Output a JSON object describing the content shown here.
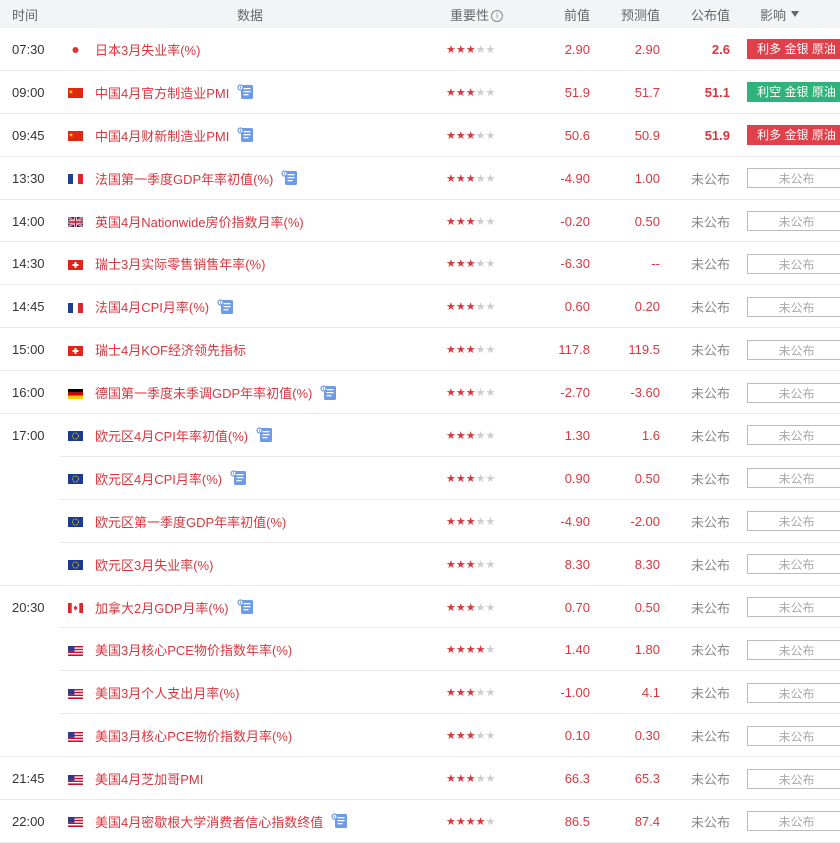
{
  "header": {
    "time": "时间",
    "data": "数据",
    "importance": "重要性",
    "previous": "前值",
    "forecast": "预测值",
    "actual": "公布值",
    "effect": "影响"
  },
  "rows": [
    {
      "time": "07:30",
      "flag": "jp",
      "name": "日本3月失业率(%)",
      "doc": false,
      "stars": 3,
      "prev": "2.90",
      "fore": "2.90",
      "act": "2.6",
      "actStyle": "bold",
      "effect": "利多 金银 原油",
      "effectStyle": "red",
      "groupEnd": true
    },
    {
      "time": "09:00",
      "flag": "cn",
      "name": "中国4月官方制造业PMI",
      "doc": true,
      "stars": 3,
      "prev": "51.9",
      "fore": "51.7",
      "act": "51.1",
      "actStyle": "bold",
      "effect": "利空 金银 原油",
      "effectStyle": "green",
      "groupEnd": true
    },
    {
      "time": "09:45",
      "flag": "cn",
      "name": "中国4月财新制造业PMI",
      "doc": true,
      "stars": 3,
      "prev": "50.6",
      "fore": "50.9",
      "act": "51.9",
      "actStyle": "bold",
      "effect": "利多 金银 原油",
      "effectStyle": "red",
      "groupEnd": true
    },
    {
      "time": "13:30",
      "flag": "fr",
      "name": "法国第一季度GDP年率初值(%)",
      "doc": true,
      "stars": 3,
      "prev": "-4.90",
      "fore": "1.00",
      "act": "未公布",
      "actStyle": "unpub",
      "effect": "未公布",
      "effectStyle": "none",
      "groupEnd": true
    },
    {
      "time": "14:00",
      "flag": "uk",
      "name": "英国4月Nationwide房价指数月率(%)",
      "doc": false,
      "stars": 3,
      "prev": "-0.20",
      "fore": "0.50",
      "act": "未公布",
      "actStyle": "unpub",
      "effect": "未公布",
      "effectStyle": "none",
      "groupEnd": true
    },
    {
      "time": "14:30",
      "flag": "ch",
      "name": "瑞士3月实际零售销售年率(%)",
      "doc": false,
      "stars": 3,
      "prev": "-6.30",
      "fore": "--",
      "act": "未公布",
      "actStyle": "unpub",
      "effect": "未公布",
      "effectStyle": "none",
      "groupEnd": true
    },
    {
      "time": "14:45",
      "flag": "fr",
      "name": "法国4月CPI月率(%)",
      "doc": true,
      "stars": 3,
      "prev": "0.60",
      "fore": "0.20",
      "act": "未公布",
      "actStyle": "unpub",
      "effect": "未公布",
      "effectStyle": "none",
      "groupEnd": true
    },
    {
      "time": "15:00",
      "flag": "ch",
      "name": "瑞士4月KOF经济领先指标",
      "doc": false,
      "stars": 3,
      "prev": "117.8",
      "fore": "119.5",
      "act": "未公布",
      "actStyle": "unpub",
      "effect": "未公布",
      "effectStyle": "none",
      "groupEnd": true
    },
    {
      "time": "16:00",
      "flag": "de",
      "name": "德国第一季度未季调GDP年率初值(%)",
      "doc": true,
      "stars": 3,
      "prev": "-2.70",
      "fore": "-3.60",
      "act": "未公布",
      "actStyle": "unpub",
      "effect": "未公布",
      "effectStyle": "none",
      "groupEnd": true
    },
    {
      "time": "17:00",
      "flag": "eu",
      "name": "欧元区4月CPI年率初值(%)",
      "doc": true,
      "stars": 3,
      "prev": "1.30",
      "fore": "1.6",
      "act": "未公布",
      "actStyle": "unpub",
      "effect": "未公布",
      "effectStyle": "none",
      "groupEnd": false
    },
    {
      "time": "",
      "flag": "eu",
      "name": "欧元区4月CPI月率(%)",
      "doc": true,
      "stars": 3,
      "prev": "0.90",
      "fore": "0.50",
      "act": "未公布",
      "actStyle": "unpub",
      "effect": "未公布",
      "effectStyle": "none",
      "groupEnd": false
    },
    {
      "time": "",
      "flag": "eu",
      "name": "欧元区第一季度GDP年率初值(%)",
      "doc": false,
      "stars": 3,
      "prev": "-4.90",
      "fore": "-2.00",
      "act": "未公布",
      "actStyle": "unpub",
      "effect": "未公布",
      "effectStyle": "none",
      "groupEnd": false
    },
    {
      "time": "",
      "flag": "eu",
      "name": "欧元区3月失业率(%)",
      "doc": false,
      "stars": 3,
      "prev": "8.30",
      "fore": "8.30",
      "act": "未公布",
      "actStyle": "unpub",
      "effect": "未公布",
      "effectStyle": "none",
      "groupEnd": true
    },
    {
      "time": "20:30",
      "flag": "ca",
      "name": "加拿大2月GDP月率(%)",
      "doc": true,
      "stars": 3,
      "prev": "0.70",
      "fore": "0.50",
      "act": "未公布",
      "actStyle": "unpub",
      "effect": "未公布",
      "effectStyle": "none",
      "groupEnd": false
    },
    {
      "time": "",
      "flag": "us",
      "name": "美国3月核心PCE物价指数年率(%)",
      "doc": false,
      "stars": 4,
      "prev": "1.40",
      "fore": "1.80",
      "act": "未公布",
      "actStyle": "unpub",
      "effect": "未公布",
      "effectStyle": "none",
      "groupEnd": false
    },
    {
      "time": "",
      "flag": "us",
      "name": "美国3月个人支出月率(%)",
      "doc": false,
      "stars": 3,
      "prev": "-1.00",
      "fore": "4.1",
      "act": "未公布",
      "actStyle": "unpub",
      "effect": "未公布",
      "effectStyle": "none",
      "groupEnd": false
    },
    {
      "time": "",
      "flag": "us",
      "name": "美国3月核心PCE物价指数月率(%)",
      "doc": false,
      "stars": 3,
      "prev": "0.10",
      "fore": "0.30",
      "act": "未公布",
      "actStyle": "unpub",
      "effect": "未公布",
      "effectStyle": "none",
      "groupEnd": true
    },
    {
      "time": "21:45",
      "flag": "us",
      "name": "美国4月芝加哥PMI",
      "doc": false,
      "stars": 3,
      "prev": "66.3",
      "fore": "65.3",
      "act": "未公布",
      "actStyle": "unpub",
      "effect": "未公布",
      "effectStyle": "none",
      "groupEnd": true
    },
    {
      "time": "22:00",
      "flag": "us",
      "name": "美国4月密歇根大学消费者信心指数终值",
      "doc": true,
      "stars": 4,
      "prev": "86.5",
      "fore": "87.4",
      "act": "未公布",
      "actStyle": "unpub",
      "effect": "未公布",
      "effectStyle": "none",
      "groupEnd": true
    }
  ],
  "colors": {
    "accent": "#d9363e",
    "bullish": "#e0404a",
    "bearish": "#2fb37a",
    "header_bg": "#f3f4f6"
  }
}
